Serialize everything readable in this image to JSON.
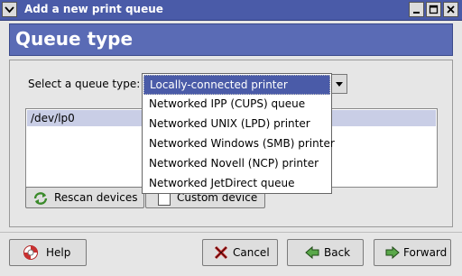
{
  "window": {
    "title": "Add a new print queue"
  },
  "banner": {
    "title": "Queue type"
  },
  "queue_type": {
    "label": "Select a queue type:",
    "options": [
      "Locally-connected printer",
      "Networked IPP (CUPS) queue",
      "Networked UNIX (LPD) printer",
      "Networked Windows (SMB) printer",
      "Networked Novell (NCP) printer",
      "Networked JetDirect queue"
    ],
    "selected": "Locally-connected printer"
  },
  "devices": {
    "items": [
      "/dev/lp0"
    ]
  },
  "buttons": {
    "rescan": "Rescan devices",
    "custom": "Custom device",
    "help": "Help",
    "cancel": "Cancel",
    "back": "Back",
    "forward": "Forward"
  },
  "colors": {
    "titlebar": "#4a5ba8",
    "banner": "#5a6bb5",
    "selection": "#4a5ba8",
    "list_selection": "#c9cee6"
  },
  "icons": {
    "menu": "chevron-down-icon",
    "minimize": "minimize-icon",
    "maximize": "maximize-icon",
    "close": "close-icon",
    "rescan": "refresh-icon",
    "help": "lifebuoy-icon",
    "cancel": "x-icon",
    "back": "arrow-left-icon",
    "forward": "arrow-right-icon"
  }
}
